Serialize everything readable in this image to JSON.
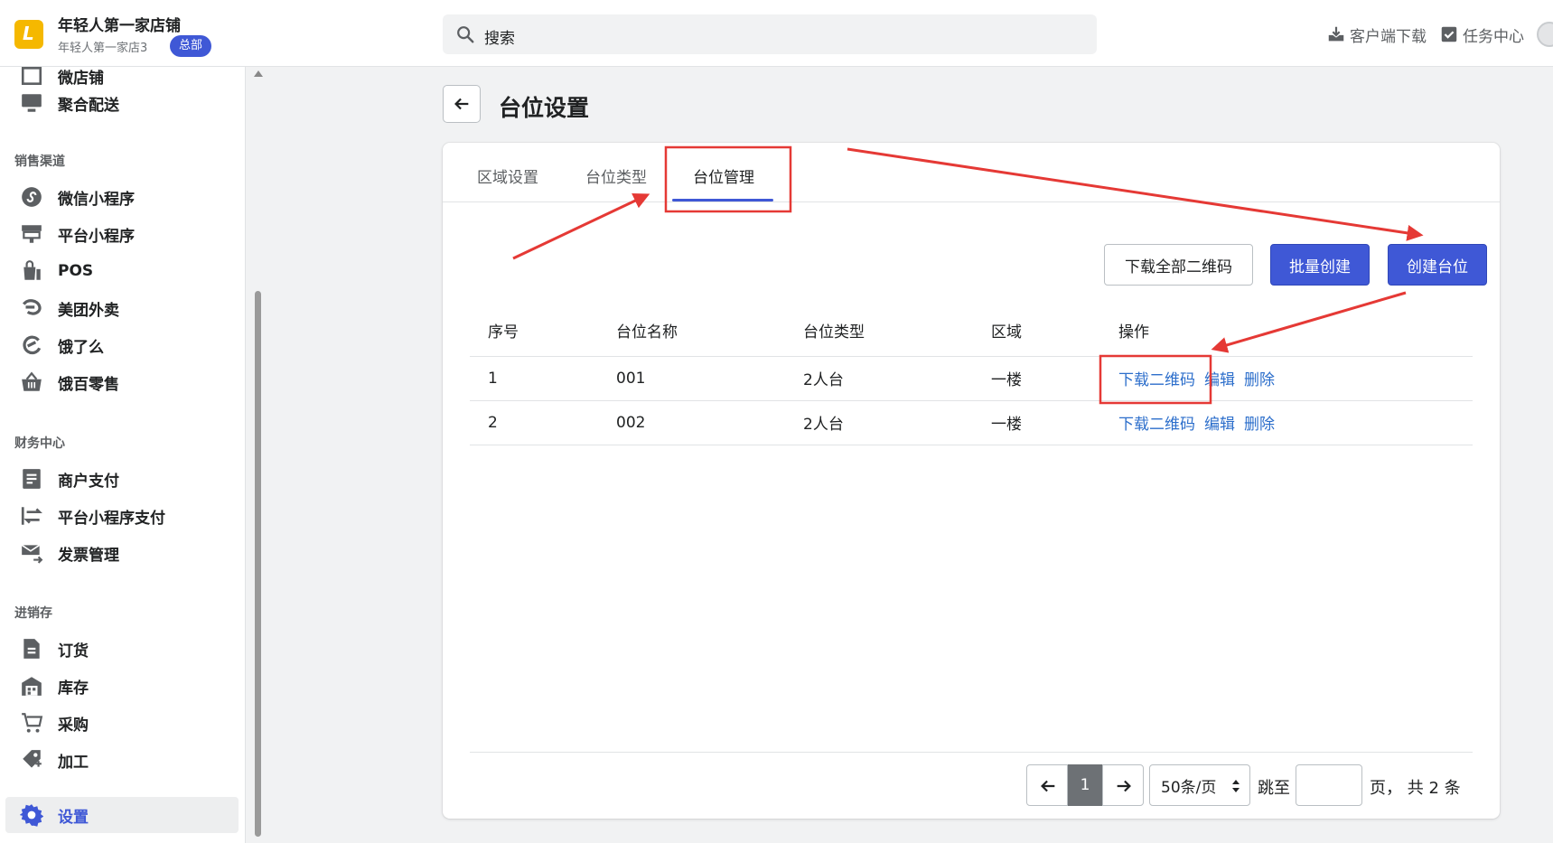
{
  "header": {
    "shop_name": "年轻人第一家店铺",
    "shop_sub": "年轻人第一家店3",
    "hq_badge": "总部",
    "search_placeholder": "搜索",
    "client_download": "客户端下载",
    "task_center": "任务中心"
  },
  "sidebar": {
    "items_top": [
      {
        "label": "微店铺",
        "icon": "store-icon"
      },
      {
        "label": "聚合配送",
        "icon": "monitor-icon"
      }
    ],
    "groups": [
      {
        "title": "销售渠道",
        "items": [
          {
            "label": "微信小程序",
            "icon": "miniprogram-icon"
          },
          {
            "label": "平台小程序",
            "icon": "kiosk-icon"
          },
          {
            "label": "POS",
            "icon": "pos-icon"
          },
          {
            "label": "美团外卖",
            "icon": "meituan-icon"
          },
          {
            "label": "饿了么",
            "icon": "eleme-icon"
          },
          {
            "label": "饿百零售",
            "icon": "basket-icon"
          }
        ]
      },
      {
        "title": "财务中心",
        "items": [
          {
            "label": "商户支付",
            "icon": "document-icon"
          },
          {
            "label": "平台小程序支付",
            "icon": "transfer-icon"
          },
          {
            "label": "发票管理",
            "icon": "invoice-icon"
          }
        ]
      },
      {
        "title": "进销存",
        "items": [
          {
            "label": "订货",
            "icon": "order-icon"
          },
          {
            "label": "库存",
            "icon": "warehouse-icon"
          },
          {
            "label": "采购",
            "icon": "purchase-icon"
          },
          {
            "label": "加工",
            "icon": "process-icon"
          }
        ]
      }
    ],
    "settings": "设置"
  },
  "page": {
    "title": "台位设置",
    "tabs": [
      "区域设置",
      "台位类型",
      "台位管理"
    ],
    "active_tab": "台位管理",
    "buttons": {
      "download_all": "下载全部二维码",
      "batch_create": "批量创建",
      "create": "创建台位"
    },
    "table": {
      "columns": [
        "序号",
        "台位名称",
        "台位类型",
        "区域",
        "操作"
      ],
      "rows": [
        {
          "index": "1",
          "name": "001",
          "type": "2人台",
          "area": "一楼"
        },
        {
          "index": "2",
          "name": "002",
          "type": "2人台",
          "area": "一楼"
        }
      ],
      "ops": {
        "download": "下载二维码",
        "edit": "编辑",
        "delete": "删除"
      }
    },
    "pagination": {
      "current": "1",
      "page_size": "50条/页",
      "jump_label": "跳至",
      "total": "页， 共 2 条"
    }
  },
  "colors": {
    "accent": "#3f58d6",
    "link": "#2c6ecb",
    "annotation": "#e53935"
  }
}
